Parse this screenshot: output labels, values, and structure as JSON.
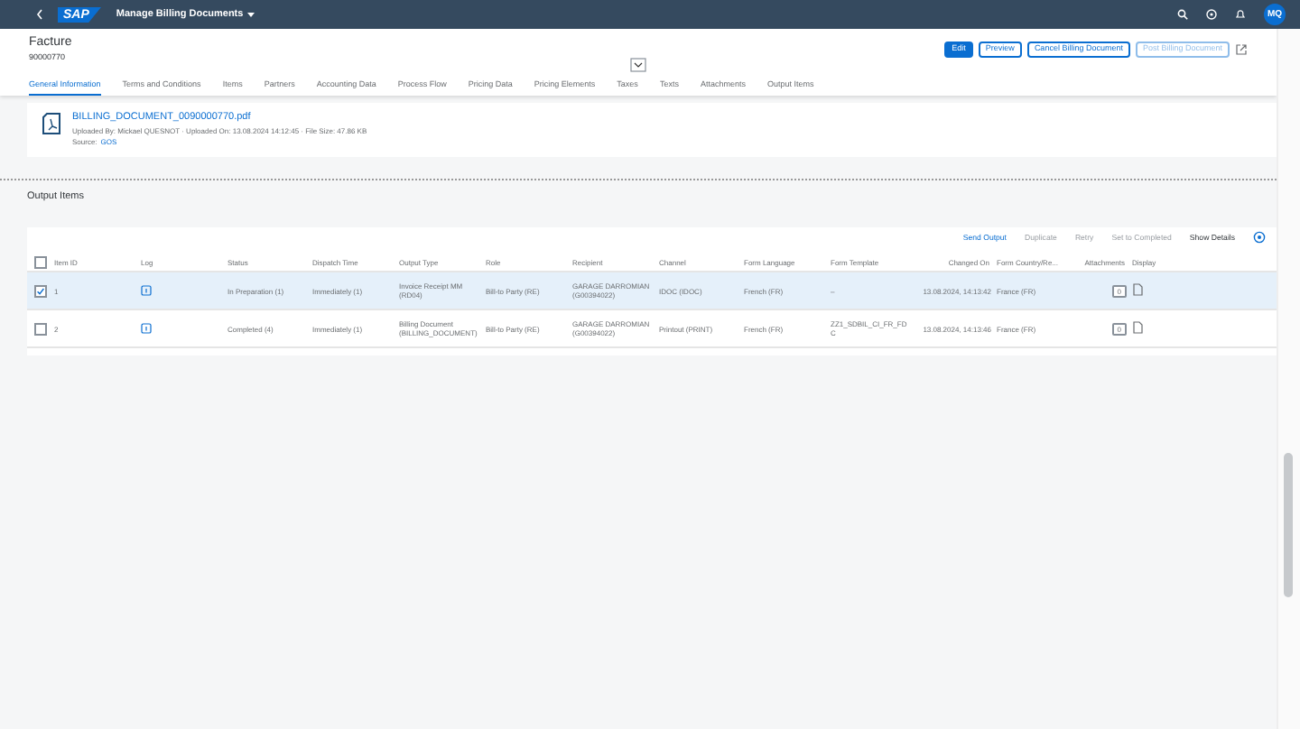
{
  "shell": {
    "logo": "SAP",
    "title": "Manage Billing Documents",
    "user_initials": "MQ"
  },
  "header": {
    "title": "Facture",
    "id": "90000770",
    "buttons": [
      {
        "label": "Edit",
        "kind": "emphasized",
        "disabled": false
      },
      {
        "label": "Preview",
        "kind": "default",
        "disabled": false
      },
      {
        "label": "Cancel Billing Document",
        "kind": "default",
        "disabled": false
      },
      {
        "label": "Post Billing Document",
        "kind": "default",
        "disabled": true
      }
    ]
  },
  "tabs": [
    {
      "label": "General Information",
      "selected": true
    },
    {
      "label": "Terms and Conditions",
      "selected": false
    },
    {
      "label": "Items",
      "selected": false
    },
    {
      "label": "Partners",
      "selected": false
    },
    {
      "label": "Accounting Data",
      "selected": false
    },
    {
      "label": "Process Flow",
      "selected": false
    },
    {
      "label": "Pricing Data",
      "selected": false
    },
    {
      "label": "Pricing Elements",
      "selected": false
    },
    {
      "label": "Taxes",
      "selected": false
    },
    {
      "label": "Texts",
      "selected": false
    },
    {
      "label": "Attachments",
      "selected": false
    },
    {
      "label": "Output Items",
      "selected": false
    }
  ],
  "attachment": {
    "file_name": "BILLING_DOCUMENT_0090000770.pdf",
    "details": "Uploaded By: Mickael QUESNOT · Uploaded On: 13.08.2024 14:12:45 · File Size: 47.86 KB",
    "source_label": "Source:",
    "source_value": "GOS"
  },
  "section_title": "Output Items",
  "toolbar": [
    {
      "label": "Send Output",
      "disabled": false
    },
    {
      "label": "Duplicate",
      "disabled": true
    },
    {
      "label": "Retry",
      "disabled": true
    },
    {
      "label": "Set to Completed",
      "disabled": true
    },
    {
      "label": "Show Details",
      "disabled": false
    }
  ],
  "table": {
    "select_all": false,
    "columns": [
      "Item ID",
      "Log",
      "Status",
      "Dispatch Time",
      "Output Type",
      "Role",
      "Recipient",
      "Channel",
      "Form Language",
      "Form Template",
      "Changed On",
      "Form Country/Re...",
      "Attachments",
      "Display"
    ],
    "rows": [
      {
        "selected": true,
        "item_id": "1",
        "status": "In Preparation (1)",
        "dispatch_time": "Immediately (1)",
        "output_type": "Invoice Receipt MM (RD04)",
        "role": "Bill-to Party (RE)",
        "recipient": "GARAGE DARROMIAN (G00394022)",
        "channel": "IDOC (IDOC)",
        "form_language": "French (FR)",
        "form_template": "–",
        "changed_on": "13.08.2024, 14:13:42",
        "form_country": "France (FR)",
        "attachments": "0"
      },
      {
        "selected": false,
        "item_id": "2",
        "status": "Completed (4)",
        "dispatch_time": "Immediately (1)",
        "output_type": "Billing Document (BILLING_DOCUMENT)",
        "role": "Bill-to Party (RE)",
        "recipient": "GARAGE DARROMIAN (G00394022)",
        "channel": "Printout (PRINT)",
        "form_language": "French (FR)",
        "form_template": "ZZ1_SDBIL_CI_FR_FDC",
        "changed_on": "13.08.2024, 14:13:46",
        "form_country": "France (FR)",
        "attachments": "0"
      }
    ]
  }
}
